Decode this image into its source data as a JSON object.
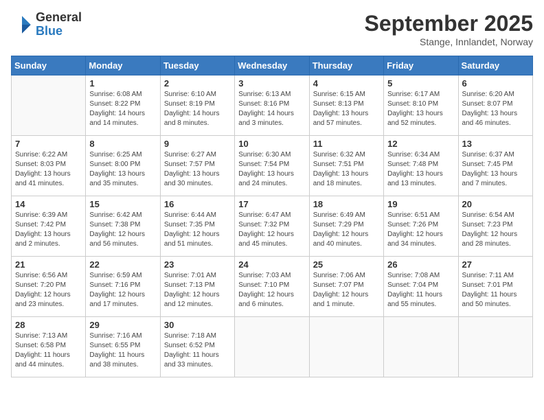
{
  "logo": {
    "general": "General",
    "blue": "Blue"
  },
  "header": {
    "month": "September 2025",
    "location": "Stange, Innlandet, Norway"
  },
  "days_of_week": [
    "Sunday",
    "Monday",
    "Tuesday",
    "Wednesday",
    "Thursday",
    "Friday",
    "Saturday"
  ],
  "weeks": [
    [
      {
        "day": "",
        "info": ""
      },
      {
        "day": "1",
        "info": "Sunrise: 6:08 AM\nSunset: 8:22 PM\nDaylight: 14 hours\nand 14 minutes."
      },
      {
        "day": "2",
        "info": "Sunrise: 6:10 AM\nSunset: 8:19 PM\nDaylight: 14 hours\nand 8 minutes."
      },
      {
        "day": "3",
        "info": "Sunrise: 6:13 AM\nSunset: 8:16 PM\nDaylight: 14 hours\nand 3 minutes."
      },
      {
        "day": "4",
        "info": "Sunrise: 6:15 AM\nSunset: 8:13 PM\nDaylight: 13 hours\nand 57 minutes."
      },
      {
        "day": "5",
        "info": "Sunrise: 6:17 AM\nSunset: 8:10 PM\nDaylight: 13 hours\nand 52 minutes."
      },
      {
        "day": "6",
        "info": "Sunrise: 6:20 AM\nSunset: 8:07 PM\nDaylight: 13 hours\nand 46 minutes."
      }
    ],
    [
      {
        "day": "7",
        "info": "Sunrise: 6:22 AM\nSunset: 8:03 PM\nDaylight: 13 hours\nand 41 minutes."
      },
      {
        "day": "8",
        "info": "Sunrise: 6:25 AM\nSunset: 8:00 PM\nDaylight: 13 hours\nand 35 minutes."
      },
      {
        "day": "9",
        "info": "Sunrise: 6:27 AM\nSunset: 7:57 PM\nDaylight: 13 hours\nand 30 minutes."
      },
      {
        "day": "10",
        "info": "Sunrise: 6:30 AM\nSunset: 7:54 PM\nDaylight: 13 hours\nand 24 minutes."
      },
      {
        "day": "11",
        "info": "Sunrise: 6:32 AM\nSunset: 7:51 PM\nDaylight: 13 hours\nand 18 minutes."
      },
      {
        "day": "12",
        "info": "Sunrise: 6:34 AM\nSunset: 7:48 PM\nDaylight: 13 hours\nand 13 minutes."
      },
      {
        "day": "13",
        "info": "Sunrise: 6:37 AM\nSunset: 7:45 PM\nDaylight: 13 hours\nand 7 minutes."
      }
    ],
    [
      {
        "day": "14",
        "info": "Sunrise: 6:39 AM\nSunset: 7:42 PM\nDaylight: 13 hours\nand 2 minutes."
      },
      {
        "day": "15",
        "info": "Sunrise: 6:42 AM\nSunset: 7:38 PM\nDaylight: 12 hours\nand 56 minutes."
      },
      {
        "day": "16",
        "info": "Sunrise: 6:44 AM\nSunset: 7:35 PM\nDaylight: 12 hours\nand 51 minutes."
      },
      {
        "day": "17",
        "info": "Sunrise: 6:47 AM\nSunset: 7:32 PM\nDaylight: 12 hours\nand 45 minutes."
      },
      {
        "day": "18",
        "info": "Sunrise: 6:49 AM\nSunset: 7:29 PM\nDaylight: 12 hours\nand 40 minutes."
      },
      {
        "day": "19",
        "info": "Sunrise: 6:51 AM\nSunset: 7:26 PM\nDaylight: 12 hours\nand 34 minutes."
      },
      {
        "day": "20",
        "info": "Sunrise: 6:54 AM\nSunset: 7:23 PM\nDaylight: 12 hours\nand 28 minutes."
      }
    ],
    [
      {
        "day": "21",
        "info": "Sunrise: 6:56 AM\nSunset: 7:20 PM\nDaylight: 12 hours\nand 23 minutes."
      },
      {
        "day": "22",
        "info": "Sunrise: 6:59 AM\nSunset: 7:16 PM\nDaylight: 12 hours\nand 17 minutes."
      },
      {
        "day": "23",
        "info": "Sunrise: 7:01 AM\nSunset: 7:13 PM\nDaylight: 12 hours\nand 12 minutes."
      },
      {
        "day": "24",
        "info": "Sunrise: 7:03 AM\nSunset: 7:10 PM\nDaylight: 12 hours\nand 6 minutes."
      },
      {
        "day": "25",
        "info": "Sunrise: 7:06 AM\nSunset: 7:07 PM\nDaylight: 12 hours\nand 1 minute."
      },
      {
        "day": "26",
        "info": "Sunrise: 7:08 AM\nSunset: 7:04 PM\nDaylight: 11 hours\nand 55 minutes."
      },
      {
        "day": "27",
        "info": "Sunrise: 7:11 AM\nSunset: 7:01 PM\nDaylight: 11 hours\nand 50 minutes."
      }
    ],
    [
      {
        "day": "28",
        "info": "Sunrise: 7:13 AM\nSunset: 6:58 PM\nDaylight: 11 hours\nand 44 minutes."
      },
      {
        "day": "29",
        "info": "Sunrise: 7:16 AM\nSunset: 6:55 PM\nDaylight: 11 hours\nand 38 minutes."
      },
      {
        "day": "30",
        "info": "Sunrise: 7:18 AM\nSunset: 6:52 PM\nDaylight: 11 hours\nand 33 minutes."
      },
      {
        "day": "",
        "info": ""
      },
      {
        "day": "",
        "info": ""
      },
      {
        "day": "",
        "info": ""
      },
      {
        "day": "",
        "info": ""
      }
    ]
  ]
}
